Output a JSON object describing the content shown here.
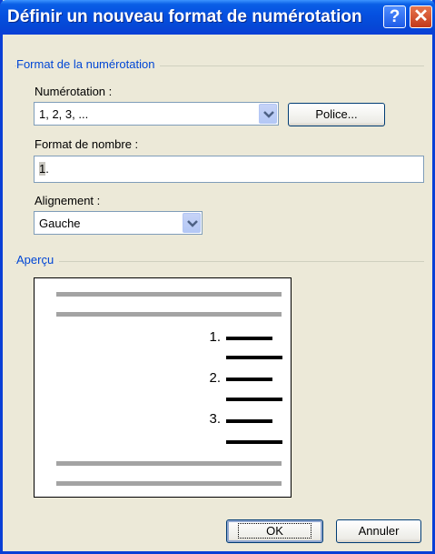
{
  "window": {
    "title": "Définir un nouveau format de numérotation"
  },
  "titlebar": {
    "help_icon": "question-mark-icon",
    "close_icon": "close-x-icon",
    "help_glyph": "?",
    "close_glyph": "✕"
  },
  "format_group": {
    "label": "Format de la numérotation",
    "numbering_label": "Numérotation :",
    "numbering_value": "1, 2, 3, ...",
    "font_button_label": "Police...",
    "number_format_label": "Format de nombre :",
    "number_format_value_field": "1",
    "number_format_value_suffix": ".",
    "alignment_label": "Alignement :",
    "alignment_value": "Gauche"
  },
  "preview_group": {
    "label": "Aperçu",
    "items": [
      "1.",
      "2.",
      "3."
    ]
  },
  "buttons": {
    "ok_label": "OK",
    "cancel_label": "Annuler"
  },
  "colors": {
    "titlebar": "#0551e1",
    "group_label": "#0046d5",
    "dialog_bg": "#ece9d8"
  }
}
